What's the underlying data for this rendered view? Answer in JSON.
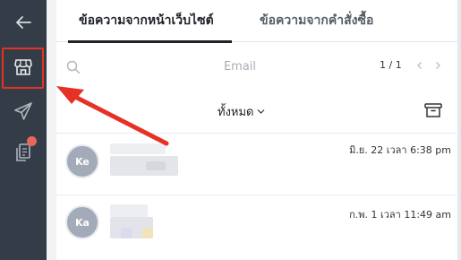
{
  "sidebar": {
    "back": "back-arrow-icon",
    "shop": "storefront-icon",
    "send": "paper-plane-icon",
    "notes": "document-stack-icon"
  },
  "tabs": [
    {
      "label": "ข้อความจากหน้าเว็บไซต์",
      "active": true
    },
    {
      "label": "ข้อความจากคำสั่งซื้อ",
      "active": false
    }
  ],
  "search": {
    "placeholder": "Email",
    "value": ""
  },
  "pagination": {
    "text": "1 / 1"
  },
  "filter": {
    "label": "ทั้งหมด"
  },
  "conversations": [
    {
      "initials": "Ke",
      "time": "มิ.ย. 22 เวลา 6:38 pm"
    },
    {
      "initials": "Ka",
      "time": "ก.พ. 1 เวลา 11:49 am"
    }
  ],
  "colors": {
    "sidebar_bg": "#343c47",
    "highlight": "#e53224",
    "badge": "#e6675a",
    "avatar": "#a3aab8"
  }
}
